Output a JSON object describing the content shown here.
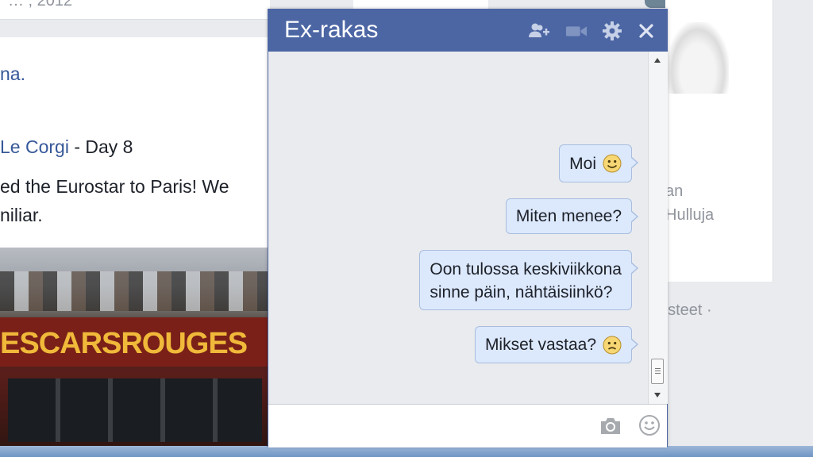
{
  "background": {
    "top_partial_text": "… , 2012",
    "feed_link_fragment": "na.",
    "post_author_link": "Le Corgi",
    "post_title_rest": " - Day 8",
    "post_text_line1": "ed the Eurostar to Paris! We",
    "post_text_line2": "niliar.",
    "photo_sign_text": "ESCARSROUGES",
    "right_text1": "an",
    "right_text2": "Hulluja",
    "right_text3": "ästeet ·"
  },
  "chat": {
    "title": "Ex-rakas",
    "header_color": "#4c66a4",
    "icons": [
      "add-friend-icon",
      "video-call-icon",
      "gear-icon",
      "close-icon"
    ],
    "messages": [
      {
        "text": "Moi",
        "emoji": "smile"
      },
      {
        "text": "Miten menee?",
        "emoji": ""
      },
      {
        "text": "Oon tulossa keskiviikkona sinne päin, nähtäisiinkö?",
        "line1": "Oon tulossa keskiviikkona",
        "line2": "sinne päin, nähtäisiinkö?",
        "emoji": ""
      },
      {
        "text": "Mikset vastaa?",
        "emoji": "frown"
      }
    ],
    "composer_placeholder": "",
    "bubble_color": "#dce8fc"
  }
}
